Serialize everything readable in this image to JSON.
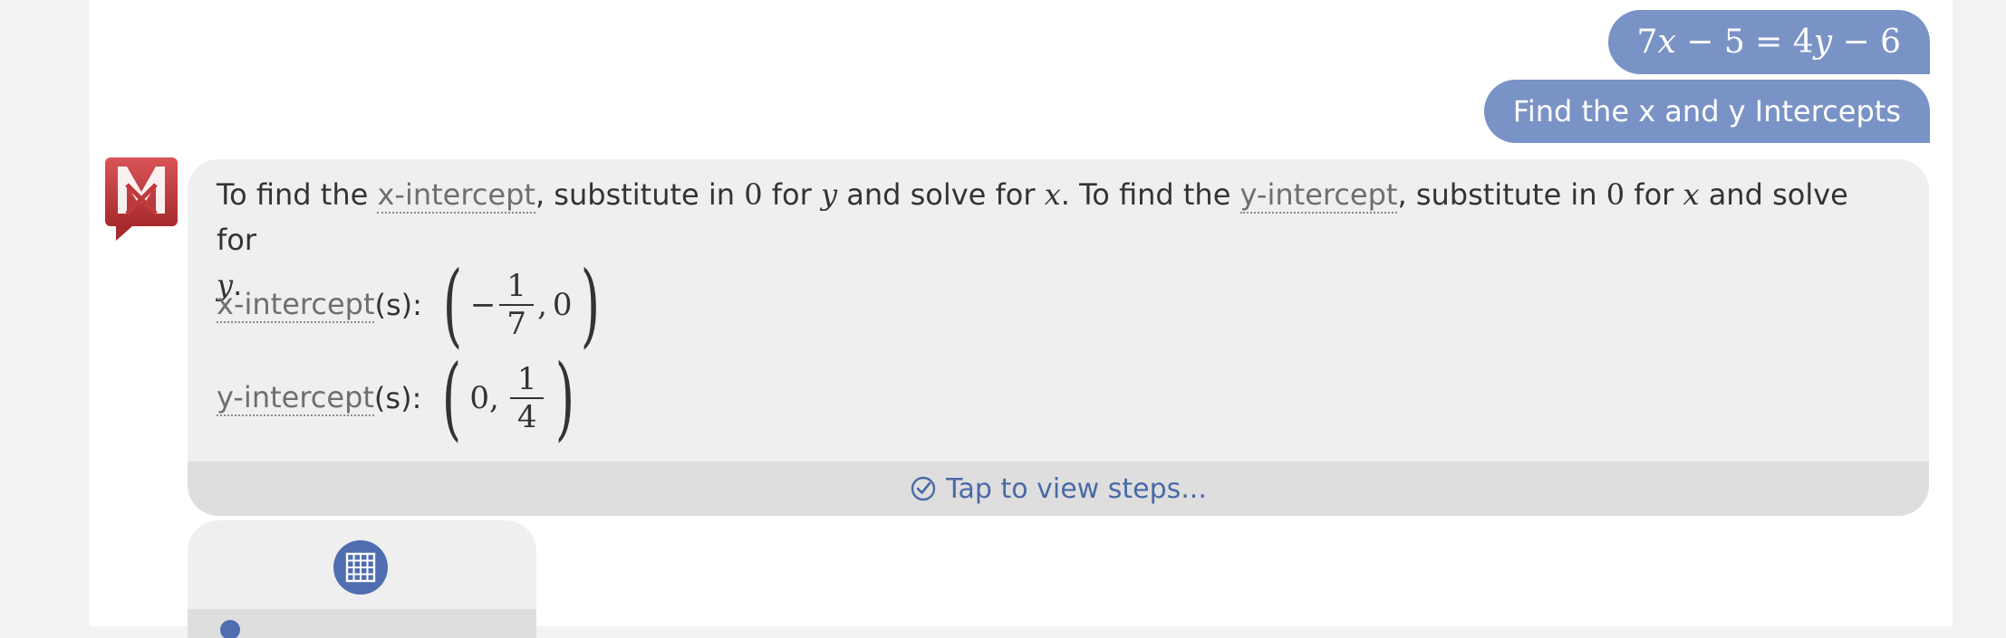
{
  "user": {
    "equation": {
      "lhs_coef": "7",
      "var_x": "x",
      "minus1": " − ",
      "lhs_const": "5",
      "equals": " = ",
      "rhs_coef": "4",
      "var_y": "y",
      "minus2": " − ",
      "rhs_const": "6"
    },
    "command": "Find the x and y Intercepts"
  },
  "answer": {
    "intro": {
      "t1": "To find the ",
      "term_x": "x-intercept",
      "t2": ", substitute in ",
      "zero": "0",
      "t3": " for ",
      "var_y": "y",
      "t4": " and solve for ",
      "var_x": "x",
      "t5": ". To find the ",
      "term_y": "y-intercept",
      "t6": ", substitute in ",
      "t7": " for ",
      "t8": " and solve for",
      "period": "."
    },
    "x_result": {
      "term": "x-intercept",
      "suffix": "(s):",
      "neg": "−",
      "numerator": "1",
      "denominator": "7",
      "comma": ",",
      "y_value": "0",
      "open": "(",
      "close": ")"
    },
    "y_result": {
      "term": "y-intercept",
      "suffix": "(s):",
      "x_value": "0",
      "comma": ",",
      "numerator": "1",
      "denominator": "4",
      "open": "(",
      "close": ")"
    },
    "steps_label": "Tap to view steps..."
  },
  "icons": {
    "avatar": "mathway-logo-icon",
    "steps": "check-circle-icon",
    "graph": "grid-graph-icon"
  },
  "colors": {
    "user_bubble": "#7a93c6",
    "accent": "#4f6db0",
    "logo_red": "#c0393b",
    "steps_text": "#4a6aa6"
  }
}
